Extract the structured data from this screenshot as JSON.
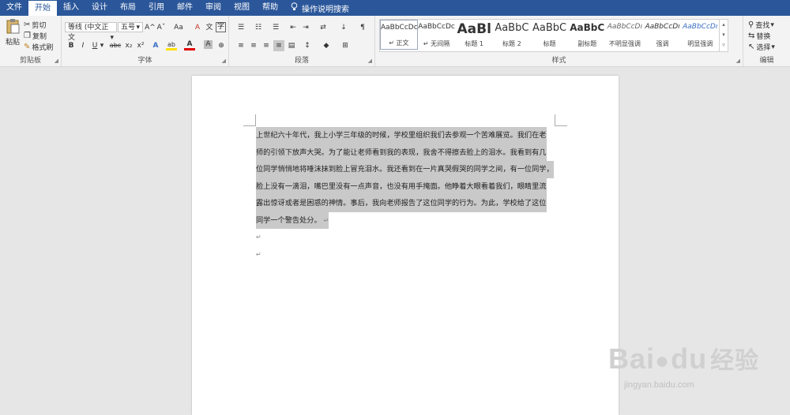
{
  "tabs": [
    "文件",
    "开始",
    "插入",
    "设计",
    "布局",
    "引用",
    "邮件",
    "审阅",
    "视图",
    "帮助"
  ],
  "tell_me": "操作说明搜索",
  "clipboard": {
    "paste": "粘贴",
    "cut": "剪切",
    "copy": "复制",
    "painter": "格式刷",
    "label": "剪贴板"
  },
  "font": {
    "name": "等线 (中文正文",
    "size": "五号",
    "label": "字体",
    "bold": "B",
    "italic": "I",
    "underline": "U",
    "strike": "abc",
    "sub": "x₂",
    "sup": "x²",
    "grow": "A^",
    "shrink": "Aˇ",
    "case": "Aa",
    "clear": "A",
    "font_color": "A",
    "highlight": "ab",
    "char_shade": "A",
    "enclose": "字"
  },
  "paragraph": {
    "label": "段落"
  },
  "styles": {
    "label": "样式",
    "items": [
      {
        "sample": "AaBbCcDc",
        "name": "正文"
      },
      {
        "sample": "AaBbCcDc",
        "name": "无间隔"
      },
      {
        "sample": "AaBl",
        "name": "标题 1"
      },
      {
        "sample": "AaBbC",
        "name": "标题 2"
      },
      {
        "sample": "AaBbC",
        "name": "标题"
      },
      {
        "sample": "AaBbC",
        "name": "副标题"
      },
      {
        "sample": "AaBbCcDı",
        "name": "不明显强调"
      },
      {
        "sample": "AaBbCcDı",
        "name": "强调"
      },
      {
        "sample": "AaBbCcDı",
        "name": "明显强调"
      }
    ]
  },
  "editing": {
    "find": "查找",
    "replace": "替换",
    "select": "选择",
    "label": "编辑"
  },
  "document": {
    "lines": [
      "上世纪六十年代，我上小学三年级的时候，学校里组织我们去参观一个苦难展览。我们在老",
      "师的引领下放声大哭。为了能让老师看到我的表现，我舍不得擦去脸上的泪水。我看到有几",
      "位同学悄悄地将唾沫抹到脸上冒充泪水。我还看到在一片真哭假哭的同学之间，有一位同学，",
      "脸上没有一滴泪，嘴巴里没有一点声音，也没有用手掩面。他睁着大眼看着我们，眼睛里流",
      "露出惊讶或者是困惑的神情。事后，我向老师报告了这位同学的行为。为此，学校给了这位",
      "同学一个警告处分。"
    ],
    "para_mark": "↵"
  },
  "watermark": {
    "main": "Bai",
    "main2": "百",
    "brand": "经验",
    "sub": "jingyan.baidu.com"
  }
}
